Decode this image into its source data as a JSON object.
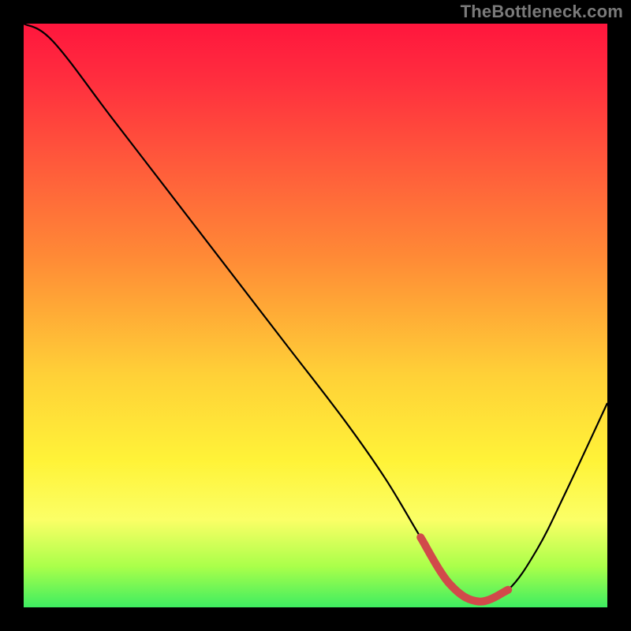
{
  "watermark": "TheBottleneck.com",
  "chart_data": {
    "type": "line",
    "title": "",
    "xlabel": "",
    "ylabel": "",
    "xlim": [
      0,
      100
    ],
    "ylim": [
      0,
      100
    ],
    "series": [
      {
        "name": "curve",
        "x": [
          0,
          5,
          15,
          25,
          35,
          45,
          55,
          62,
          68,
          73,
          78,
          83,
          88,
          93,
          100
        ],
        "values": [
          100,
          97,
          84,
          71,
          58,
          45,
          32,
          22,
          12,
          4,
          1,
          3,
          10,
          20,
          35
        ]
      }
    ],
    "highlight_range": {
      "x_start": 68,
      "x_end": 83
    },
    "background_gradient": {
      "direction": "top_to_bottom",
      "stops": [
        {
          "pos": 0,
          "color": "#ff163d"
        },
        {
          "pos": 40,
          "color": "#ff8a36"
        },
        {
          "pos": 75,
          "color": "#fff338"
        },
        {
          "pos": 100,
          "color": "#3eed61"
        }
      ]
    }
  }
}
